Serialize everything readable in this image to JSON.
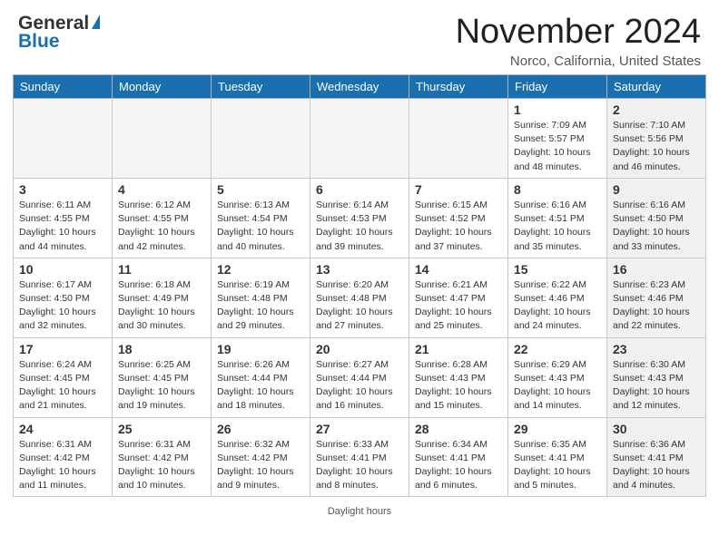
{
  "header": {
    "logo_general": "General",
    "logo_blue": "Blue",
    "month_year": "November 2024",
    "location": "Norco, California, United States"
  },
  "days_of_week": [
    "Sunday",
    "Monday",
    "Tuesday",
    "Wednesday",
    "Thursday",
    "Friday",
    "Saturday"
  ],
  "weeks": [
    [
      {
        "day": "",
        "empty": true,
        "shade": false
      },
      {
        "day": "",
        "empty": true,
        "shade": false
      },
      {
        "day": "",
        "empty": true,
        "shade": false
      },
      {
        "day": "",
        "empty": true,
        "shade": false
      },
      {
        "day": "",
        "empty": true,
        "shade": false
      },
      {
        "day": "1",
        "empty": false,
        "shade": false,
        "sunrise": "Sunrise: 7:09 AM",
        "sunset": "Sunset: 5:57 PM",
        "daylight": "Daylight: 10 hours and 48 minutes."
      },
      {
        "day": "2",
        "empty": false,
        "shade": true,
        "sunrise": "Sunrise: 7:10 AM",
        "sunset": "Sunset: 5:56 PM",
        "daylight": "Daylight: 10 hours and 46 minutes."
      }
    ],
    [
      {
        "day": "3",
        "empty": false,
        "shade": false,
        "sunrise": "Sunrise: 6:11 AM",
        "sunset": "Sunset: 4:55 PM",
        "daylight": "Daylight: 10 hours and 44 minutes."
      },
      {
        "day": "4",
        "empty": false,
        "shade": false,
        "sunrise": "Sunrise: 6:12 AM",
        "sunset": "Sunset: 4:55 PM",
        "daylight": "Daylight: 10 hours and 42 minutes."
      },
      {
        "day": "5",
        "empty": false,
        "shade": false,
        "sunrise": "Sunrise: 6:13 AM",
        "sunset": "Sunset: 4:54 PM",
        "daylight": "Daylight: 10 hours and 40 minutes."
      },
      {
        "day": "6",
        "empty": false,
        "shade": false,
        "sunrise": "Sunrise: 6:14 AM",
        "sunset": "Sunset: 4:53 PM",
        "daylight": "Daylight: 10 hours and 39 minutes."
      },
      {
        "day": "7",
        "empty": false,
        "shade": false,
        "sunrise": "Sunrise: 6:15 AM",
        "sunset": "Sunset: 4:52 PM",
        "daylight": "Daylight: 10 hours and 37 minutes."
      },
      {
        "day": "8",
        "empty": false,
        "shade": false,
        "sunrise": "Sunrise: 6:16 AM",
        "sunset": "Sunset: 4:51 PM",
        "daylight": "Daylight: 10 hours and 35 minutes."
      },
      {
        "day": "9",
        "empty": false,
        "shade": true,
        "sunrise": "Sunrise: 6:16 AM",
        "sunset": "Sunset: 4:50 PM",
        "daylight": "Daylight: 10 hours and 33 minutes."
      }
    ],
    [
      {
        "day": "10",
        "empty": false,
        "shade": false,
        "sunrise": "Sunrise: 6:17 AM",
        "sunset": "Sunset: 4:50 PM",
        "daylight": "Daylight: 10 hours and 32 minutes."
      },
      {
        "day": "11",
        "empty": false,
        "shade": false,
        "sunrise": "Sunrise: 6:18 AM",
        "sunset": "Sunset: 4:49 PM",
        "daylight": "Daylight: 10 hours and 30 minutes."
      },
      {
        "day": "12",
        "empty": false,
        "shade": false,
        "sunrise": "Sunrise: 6:19 AM",
        "sunset": "Sunset: 4:48 PM",
        "daylight": "Daylight: 10 hours and 29 minutes."
      },
      {
        "day": "13",
        "empty": false,
        "shade": false,
        "sunrise": "Sunrise: 6:20 AM",
        "sunset": "Sunset: 4:48 PM",
        "daylight": "Daylight: 10 hours and 27 minutes."
      },
      {
        "day": "14",
        "empty": false,
        "shade": false,
        "sunrise": "Sunrise: 6:21 AM",
        "sunset": "Sunset: 4:47 PM",
        "daylight": "Daylight: 10 hours and 25 minutes."
      },
      {
        "day": "15",
        "empty": false,
        "shade": false,
        "sunrise": "Sunrise: 6:22 AM",
        "sunset": "Sunset: 4:46 PM",
        "daylight": "Daylight: 10 hours and 24 minutes."
      },
      {
        "day": "16",
        "empty": false,
        "shade": true,
        "sunrise": "Sunrise: 6:23 AM",
        "sunset": "Sunset: 4:46 PM",
        "daylight": "Daylight: 10 hours and 22 minutes."
      }
    ],
    [
      {
        "day": "17",
        "empty": false,
        "shade": false,
        "sunrise": "Sunrise: 6:24 AM",
        "sunset": "Sunset: 4:45 PM",
        "daylight": "Daylight: 10 hours and 21 minutes."
      },
      {
        "day": "18",
        "empty": false,
        "shade": false,
        "sunrise": "Sunrise: 6:25 AM",
        "sunset": "Sunset: 4:45 PM",
        "daylight": "Daylight: 10 hours and 19 minutes."
      },
      {
        "day": "19",
        "empty": false,
        "shade": false,
        "sunrise": "Sunrise: 6:26 AM",
        "sunset": "Sunset: 4:44 PM",
        "daylight": "Daylight: 10 hours and 18 minutes."
      },
      {
        "day": "20",
        "empty": false,
        "shade": false,
        "sunrise": "Sunrise: 6:27 AM",
        "sunset": "Sunset: 4:44 PM",
        "daylight": "Daylight: 10 hours and 16 minutes."
      },
      {
        "day": "21",
        "empty": false,
        "shade": false,
        "sunrise": "Sunrise: 6:28 AM",
        "sunset": "Sunset: 4:43 PM",
        "daylight": "Daylight: 10 hours and 15 minutes."
      },
      {
        "day": "22",
        "empty": false,
        "shade": false,
        "sunrise": "Sunrise: 6:29 AM",
        "sunset": "Sunset: 4:43 PM",
        "daylight": "Daylight: 10 hours and 14 minutes."
      },
      {
        "day": "23",
        "empty": false,
        "shade": true,
        "sunrise": "Sunrise: 6:30 AM",
        "sunset": "Sunset: 4:43 PM",
        "daylight": "Daylight: 10 hours and 12 minutes."
      }
    ],
    [
      {
        "day": "24",
        "empty": false,
        "shade": false,
        "sunrise": "Sunrise: 6:31 AM",
        "sunset": "Sunset: 4:42 PM",
        "daylight": "Daylight: 10 hours and 11 minutes."
      },
      {
        "day": "25",
        "empty": false,
        "shade": false,
        "sunrise": "Sunrise: 6:31 AM",
        "sunset": "Sunset: 4:42 PM",
        "daylight": "Daylight: 10 hours and 10 minutes."
      },
      {
        "day": "26",
        "empty": false,
        "shade": false,
        "sunrise": "Sunrise: 6:32 AM",
        "sunset": "Sunset: 4:42 PM",
        "daylight": "Daylight: 10 hours and 9 minutes."
      },
      {
        "day": "27",
        "empty": false,
        "shade": false,
        "sunrise": "Sunrise: 6:33 AM",
        "sunset": "Sunset: 4:41 PM",
        "daylight": "Daylight: 10 hours and 8 minutes."
      },
      {
        "day": "28",
        "empty": false,
        "shade": false,
        "sunrise": "Sunrise: 6:34 AM",
        "sunset": "Sunset: 4:41 PM",
        "daylight": "Daylight: 10 hours and 6 minutes."
      },
      {
        "day": "29",
        "empty": false,
        "shade": false,
        "sunrise": "Sunrise: 6:35 AM",
        "sunset": "Sunset: 4:41 PM",
        "daylight": "Daylight: 10 hours and 5 minutes."
      },
      {
        "day": "30",
        "empty": false,
        "shade": true,
        "sunrise": "Sunrise: 6:36 AM",
        "sunset": "Sunset: 4:41 PM",
        "daylight": "Daylight: 10 hours and 4 minutes."
      }
    ]
  ],
  "footer": {
    "daylight_label": "Daylight hours"
  }
}
